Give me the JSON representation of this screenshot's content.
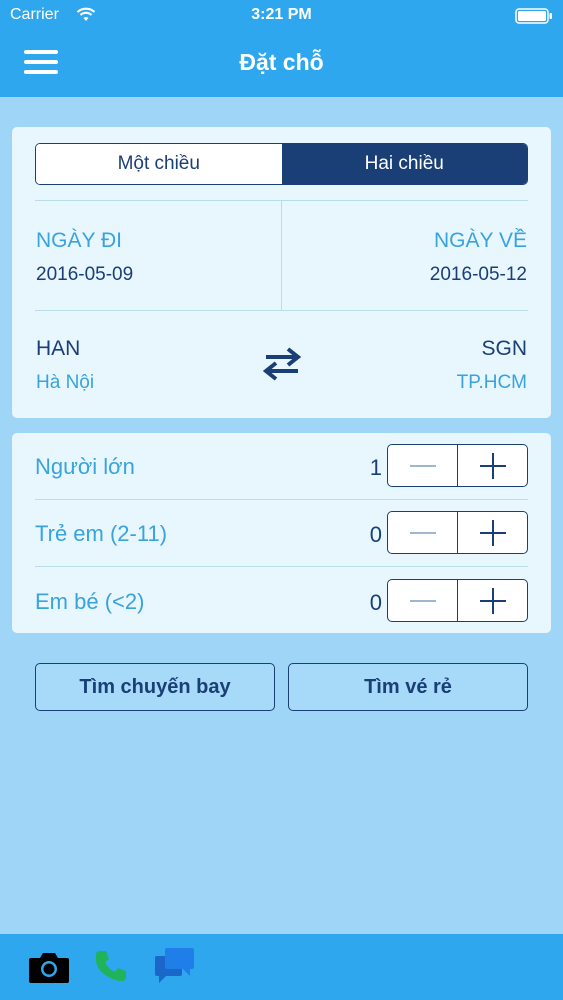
{
  "status_bar": {
    "carrier": "Carrier",
    "time": "3:21 PM",
    "icons": [
      "wifi-icon",
      "battery-icon"
    ]
  },
  "nav": {
    "title": "Đặt chỗ",
    "menu_icon": "menu-icon"
  },
  "trip_type": {
    "options": [
      "Một chiều",
      "Hai chiều"
    ],
    "selected": "Hai chiều"
  },
  "dates": {
    "depart_label": "NGÀY ĐI",
    "depart_value": "2016-05-09",
    "return_label": "NGÀY VỀ",
    "return_value": "2016-05-12"
  },
  "route": {
    "origin_code": "HAN",
    "origin_city": "Hà Nội",
    "destination_code": "SGN",
    "destination_city": "TP.HCM",
    "swap_icon": "swap-arrows-icon"
  },
  "passengers": [
    {
      "label": "Người lớn",
      "count": "1"
    },
    {
      "label": "Trẻ em (2-11)",
      "count": "0"
    },
    {
      "label": "Em bé (<2)",
      "count": "0"
    }
  ],
  "actions": {
    "search_flights": "Tìm chuyến bay",
    "find_cheap": "Tìm vé rẻ"
  },
  "toolbar": {
    "icons": [
      "camera-icon",
      "phone-icon",
      "chat-icon"
    ]
  },
  "colors": {
    "accent": "#2ea7ee",
    "navy": "#1a3f77",
    "label_blue": "#38a3dc",
    "background": "#9fd6f8",
    "card": "#e8f6fe",
    "phone_green": "#21b35a"
  }
}
